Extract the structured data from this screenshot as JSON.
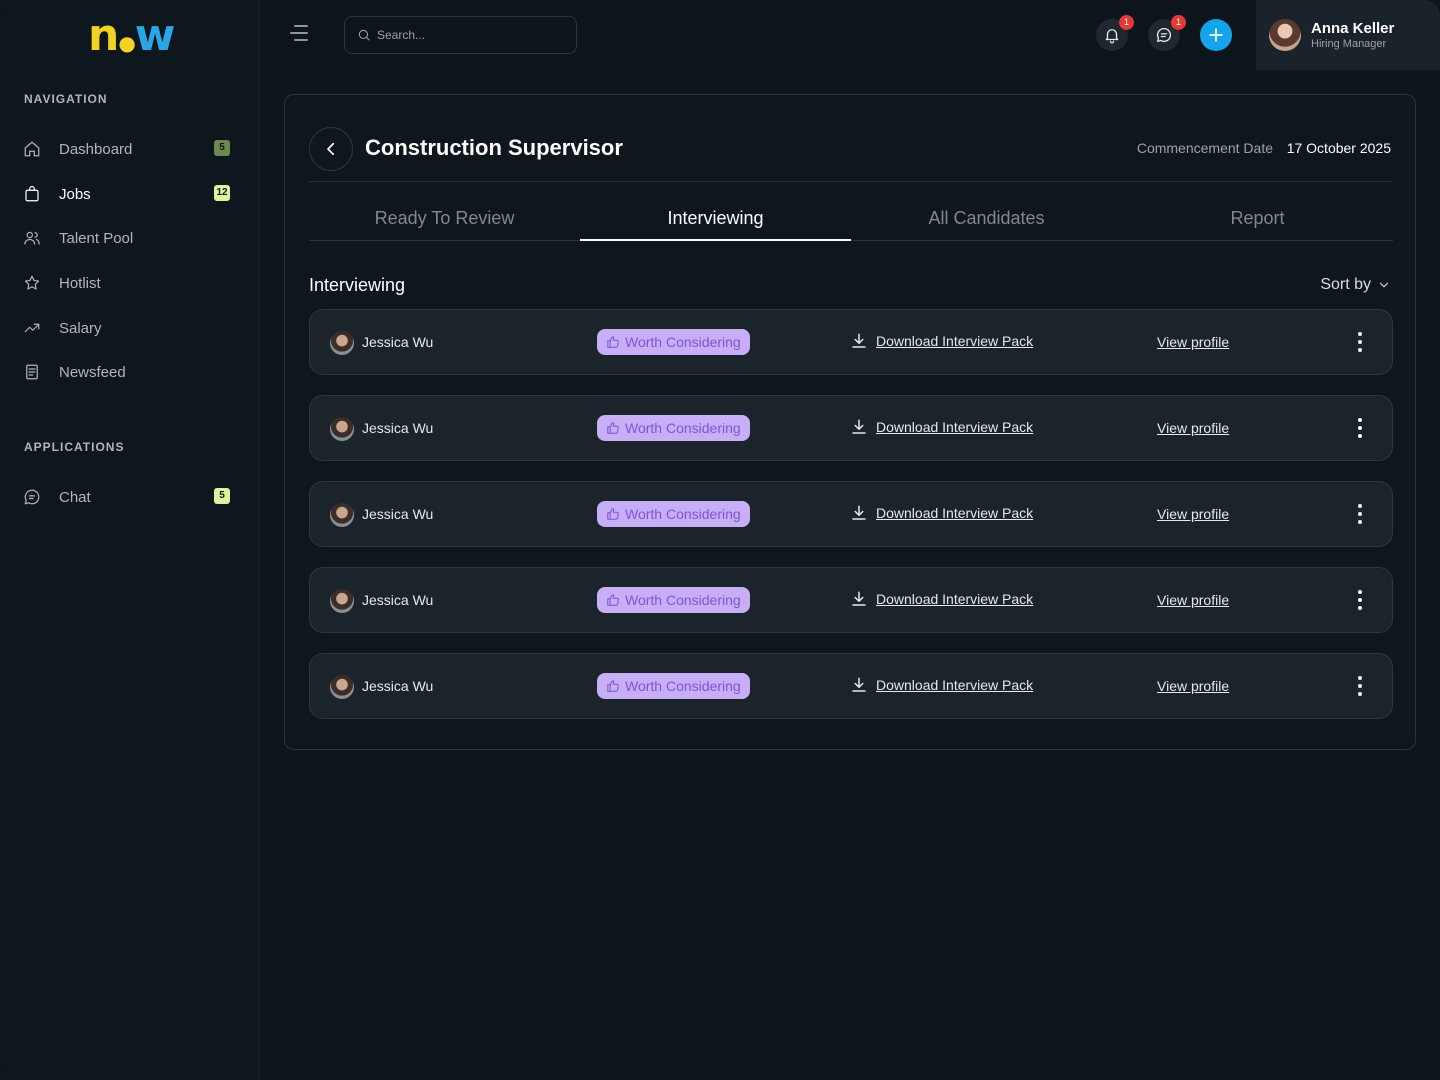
{
  "brand": {
    "logo_n": "n",
    "logo_w": "w"
  },
  "sidebar": {
    "nav_title": "NAVIGATION",
    "items": [
      {
        "label": "Dashboard",
        "icon": "home-icon",
        "badge": "5",
        "active": false
      },
      {
        "label": "Jobs",
        "icon": "briefcase-icon",
        "badge": "12",
        "active": true
      },
      {
        "label": "Talent Pool",
        "icon": "users-icon",
        "badge": "",
        "active": false
      },
      {
        "label": "Hotlist",
        "icon": "star-icon",
        "badge": "",
        "active": false
      },
      {
        "label": "Salary",
        "icon": "trending-up-icon",
        "badge": "",
        "active": false
      },
      {
        "label": "Newsfeed",
        "icon": "newspaper-icon",
        "badge": "",
        "active": false
      }
    ],
    "apps_title": "APPLICATIONS",
    "apps": [
      {
        "label": "Chat",
        "icon": "chat-icon",
        "badge": "5"
      }
    ]
  },
  "topbar": {
    "search_placeholder": "Search...",
    "notifications_count": "1",
    "messages_count": "1",
    "user": {
      "name": "Anna Keller",
      "role": "Hiring Manager"
    }
  },
  "job": {
    "title": "Construction Supervisor",
    "commencement_label": "Commencement Date",
    "commencement_date": "17 October 2025"
  },
  "tabs": [
    "Ready To Review",
    "Interviewing",
    "All Candidates",
    "Report"
  ],
  "active_tab": 1,
  "list": {
    "title": "Interviewing",
    "sort_label": "Sort by",
    "download_label": "Download Interview Pack",
    "view_label": "View profile",
    "rows": [
      {
        "name": "Jessica Wu",
        "status": "Worth Considering"
      },
      {
        "name": "Jessica Wu",
        "status": "Worth Considering"
      },
      {
        "name": "Jessica Wu",
        "status": "Worth Considering"
      },
      {
        "name": "Jessica Wu",
        "status": "Worth Considering"
      },
      {
        "name": "Jessica Wu",
        "status": "Worth Considering"
      }
    ]
  },
  "colors": {
    "background": "#0c161c",
    "badge_olive": "#6c8a4e",
    "badge_lime": "#dbf39b",
    "accent_blue": "#13a4ec",
    "notification_red": "#e53935",
    "status_pill_bg": "#c7aef7",
    "status_pill_text": "#7c55d8",
    "logo_yellow": "#f2d321",
    "logo_blue": "#2aa6e6"
  }
}
